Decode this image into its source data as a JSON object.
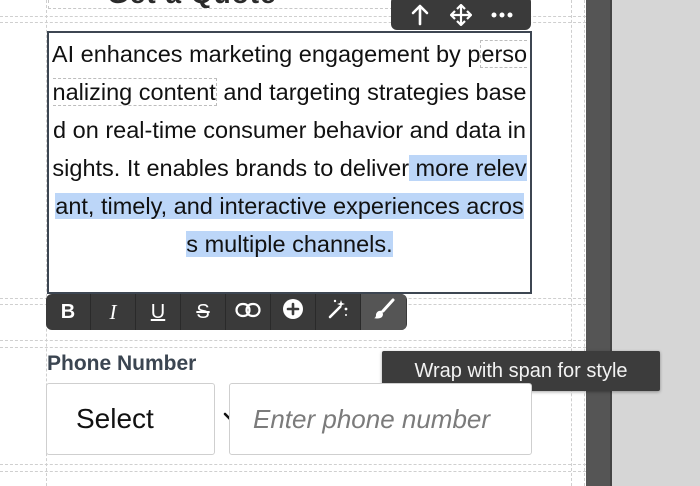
{
  "top_block": {
    "partial_heading": "Get a Quote"
  },
  "block_toolbar": {
    "icons": [
      "arrow-up-icon",
      "move-icon",
      "more-options-icon"
    ]
  },
  "text_block": {
    "seg1": "AI enhances marketing engagement by p",
    "seg2": "ersonalizing content",
    "seg3": " and targeting strategies based on real-time consumer behavior and data insights. It enables brands to deliver",
    "seg4": " more relevant, timely, and interactive experiences across multiple channels."
  },
  "format_toolbar": {
    "bold": "B",
    "italic": "I",
    "underline": "U",
    "strikethrough": "S",
    "icons": [
      "bold-icon",
      "italic-icon",
      "underline-icon",
      "strikethrough-icon",
      "link-icon",
      "add-icon",
      "magic-wand-icon",
      "brush-icon"
    ]
  },
  "tooltip": {
    "text": "Wrap with span for style"
  },
  "phone": {
    "label": "Phone Number",
    "country_select": "Select",
    "placeholder": "Enter phone number",
    "value": ""
  },
  "colors": {
    "toolbar_bg": "#3a3a3a",
    "selection_highlight": "#bcd6f8",
    "label_text": "#3b4551",
    "panel_bg": "#d6d6d6",
    "panel_border": "#555555"
  }
}
